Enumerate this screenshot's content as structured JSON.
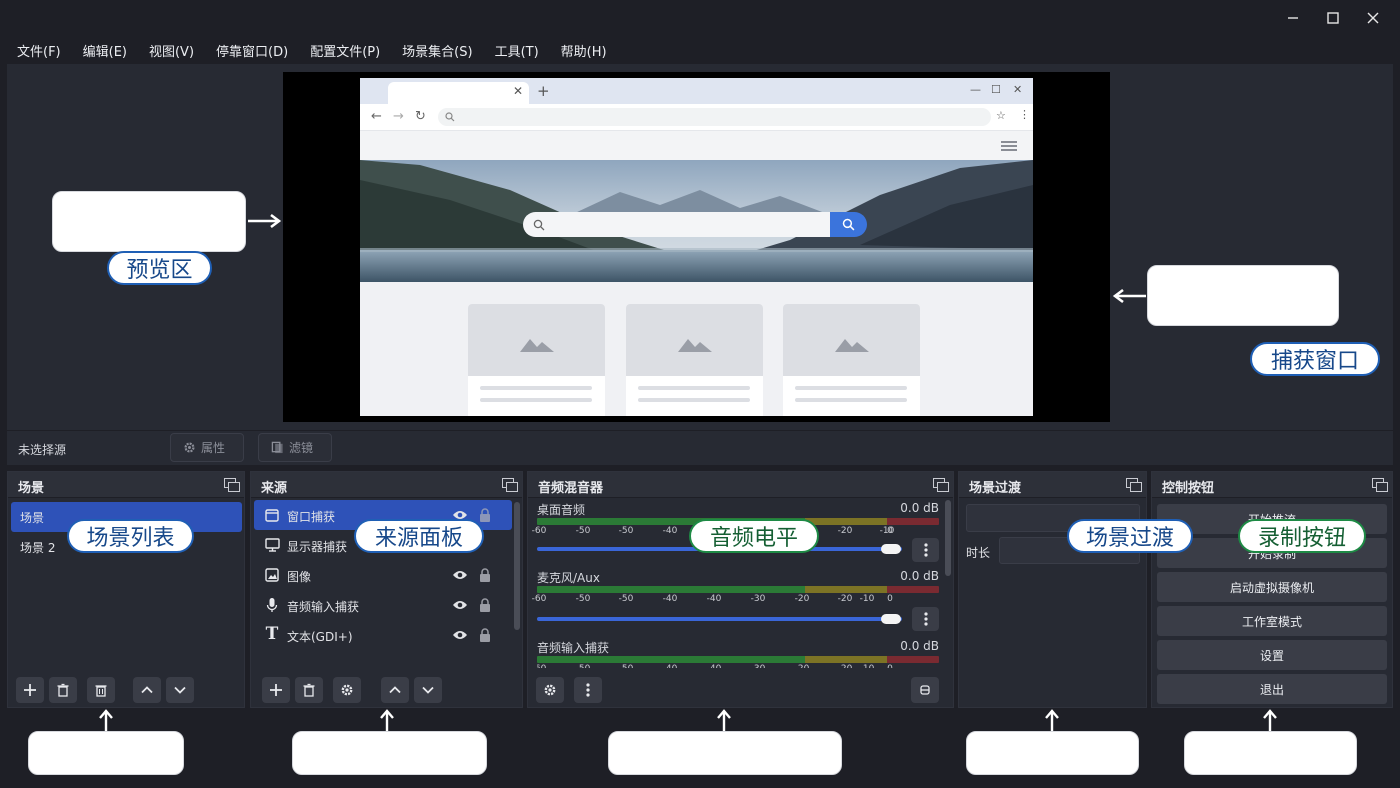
{
  "window": {
    "controls": [
      "minimize-icon",
      "maximize-icon",
      "close-icon"
    ]
  },
  "menu": [
    "文件(F)",
    "编辑(E)",
    "视图(V)",
    "停靠窗口(D)",
    "配置文件(P)",
    "场景集合(S)",
    "工具(T)",
    "帮助(H)"
  ],
  "source_toolbar": {
    "no_source": "未选择源",
    "properties": "属性",
    "filters": "滤镜"
  },
  "scenes": {
    "title": "场景",
    "items": [
      "场景",
      "场景 2"
    ],
    "selected": 0
  },
  "sources": {
    "title": "来源",
    "items": [
      {
        "label": "窗口捕获",
        "icon": "window-icon"
      },
      {
        "label": "显示器捕获",
        "icon": "monitor-icon"
      },
      {
        "label": "图像",
        "icon": "image-icon"
      },
      {
        "label": "音频输入捕获",
        "icon": "microphone-icon"
      },
      {
        "label": "文本(GDI+)",
        "icon": "text-icon"
      }
    ],
    "selected": 0
  },
  "mixer": {
    "title": "音频混音器",
    "ticks": [
      "-60",
      "-50",
      "-50",
      "-40",
      "-40",
      "-30",
      "-20",
      "-20",
      "-10",
      "0"
    ],
    "channels": [
      {
        "name": "桌面音频",
        "db": "0.0 dB",
        "level": 1.0
      },
      {
        "name": "麦克风/Aux",
        "db": "0.0 dB",
        "level": 1.0
      },
      {
        "name": "音频输入捕获",
        "db": "0.0 dB",
        "level": 1.0
      }
    ]
  },
  "transitions": {
    "title": "场景过渡",
    "duration_label": "时长"
  },
  "controls": {
    "title": "控制按钮",
    "buttons": [
      "开始推流",
      "开始录制",
      "启动虚拟摄像机",
      "工作室模式",
      "设置",
      "退出"
    ]
  },
  "callouts": {
    "preview": "预览区",
    "capture": "捕获窗口",
    "scene_list": "场景列表",
    "source_panel": "来源面板",
    "audio_level": "音频电平",
    "scene_transition": "场景过渡",
    "record_button": "录制按钮"
  },
  "colors": {
    "accent": "#2e52b8",
    "background": "#1e1f26",
    "panel": "#272a33",
    "callout_blue": "#1f5fb5",
    "callout_green": "#1e8a45"
  }
}
